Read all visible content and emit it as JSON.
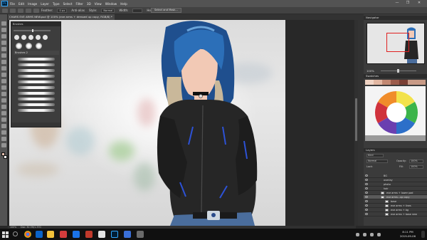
{
  "app": {
    "logo": "Ps",
    "menu": [
      "File",
      "Edit",
      "Image",
      "Layer",
      "Type",
      "Select",
      "Filter",
      "3D",
      "View",
      "Window",
      "Help"
    ],
    "window_controls": [
      "—",
      "❐",
      "✕"
    ]
  },
  "options_bar": {
    "feather_label": "Feather:",
    "feather_value": "0 px",
    "antialias_label": "Anti-alias",
    "style_label": "Style:",
    "style_value": "Normal",
    "width_label": "Width:",
    "height_label": "Height:",
    "select_mask_label": "Select and Mask..."
  },
  "document": {
    "tab_title": "CHARS EVE ARMS NEW.psd @ 100% (eve arms + dressed up copy, RGB/8) *"
  },
  "status_bar": {
    "zoom": "100%",
    "doc_info": "Doc: 30.7M/1.37G"
  },
  "brushes_panel": {
    "title": "Brushes",
    "folder_label": "Brushes 2"
  },
  "navigator_panel": {
    "title": "Navigator",
    "zoom": "100%"
  },
  "swatches_panel": {
    "title": "Swatches"
  },
  "layers_panel": {
    "title": "Layers",
    "filter_label": "Kind",
    "blend_mode": "Normal",
    "opacity_label": "Opacity:",
    "opacity_value": "100%",
    "lock_label": "Lock:",
    "fill_label": "Fill:",
    "fill_value": "100%",
    "layers": [
      "BG",
      "overlay",
      "photo",
      "hair",
      "eve arms + lower pad",
      "eve arms...up copy",
      "base",
      "eve arms + lines",
      "eve arms + bg",
      "eve arms + base new"
    ]
  },
  "taskbar": {
    "time": "8:11 PM",
    "date": "2019-09-06"
  },
  "colors": {
    "accent": "#31a8ff",
    "selection_rect": "#e02020",
    "foreground": "#e8c2b0",
    "background_swatch": "#ffffff"
  }
}
